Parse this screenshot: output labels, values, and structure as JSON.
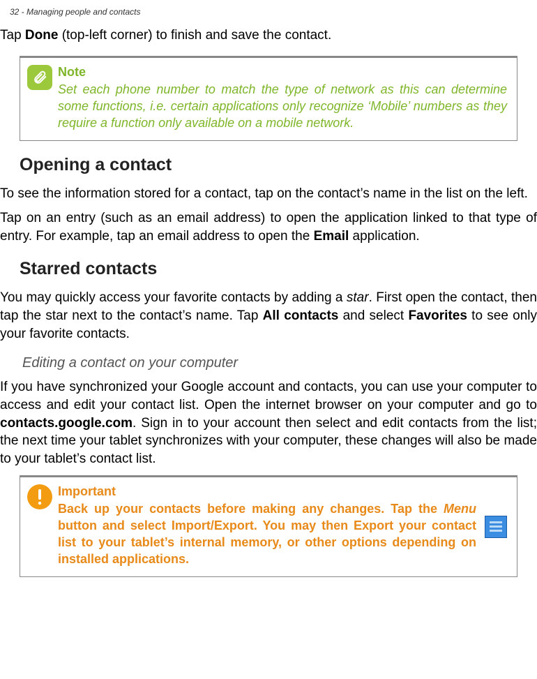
{
  "header": "32 - Managing people and contacts",
  "intro_pre": "Tap ",
  "intro_bold": "Done",
  "intro_post": " (top-left corner) to finish and save the contact.",
  "note": {
    "label": "Note",
    "body": "Set each phone number to match the type of network as this can determine some functions, i.e. certain applications only recognize ‘Mobile’ numbers as they require a function only available on a mobile network."
  },
  "opening": {
    "heading": "Opening a contact",
    "p1": "To see the information stored for a contact, tap on the contact’s name in the list on the left.",
    "p2_pre": "Tap on an entry (such as an email address) to open the application linked to that type of entry. For example, tap an email address to open the ",
    "p2_bold": "Email",
    "p2_post": " application."
  },
  "starred": {
    "heading": "Starred contacts",
    "p1_pre": "You may quickly access your favorite contacts by adding a ",
    "p1_italic": "star",
    "p1_mid": ". First open the contact, then tap the star next to the contact’s name. Tap ",
    "p1_bold1": "All contacts",
    "p1_mid2": "  and select ",
    "p1_bold2": "Favorites",
    "p1_post": " to see only your favorite contacts."
  },
  "editing": {
    "heading": "Editing a contact on your computer",
    "p1_pre": "If you have synchronized your Google account and contacts, you can use your computer to access and edit your contact list. Open the internet browser on your computer and go to ",
    "p1_bold": "contacts.google.com",
    "p1_post": ". Sign in to your account then select and edit contacts from the list; the next time your tablet synchronizes with your computer, these changes will also be made to your tablet’s contact list."
  },
  "important": {
    "label": "Important",
    "body_pre": "Back up your contacts before making any changes. Tap the ",
    "body_italic": "Menu",
    "body_post": " button and select Import/Export. You may then Export your contact list to your tablet’s internal memory, or other options depending on installed applications."
  }
}
